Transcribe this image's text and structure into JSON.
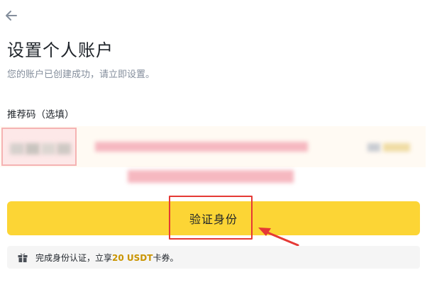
{
  "header": {
    "back_icon": "arrow-left-icon"
  },
  "page": {
    "title": "设置个人账户",
    "subtitle": "您的账户已创建成功，请立即设置。"
  },
  "referral": {
    "label": "推荐码（选填）",
    "value": ""
  },
  "actions": {
    "verify_label": "验证身份"
  },
  "reward": {
    "icon": "gift-icon",
    "text_before": "完成身份认证，立享",
    "amount": "20 USDT",
    "text_after": "卡券。"
  },
  "colors": {
    "brand_yellow": "#fcd535",
    "highlight_red": "#e53935",
    "reward_amount": "#c99400",
    "muted_text": "#848e9c"
  }
}
